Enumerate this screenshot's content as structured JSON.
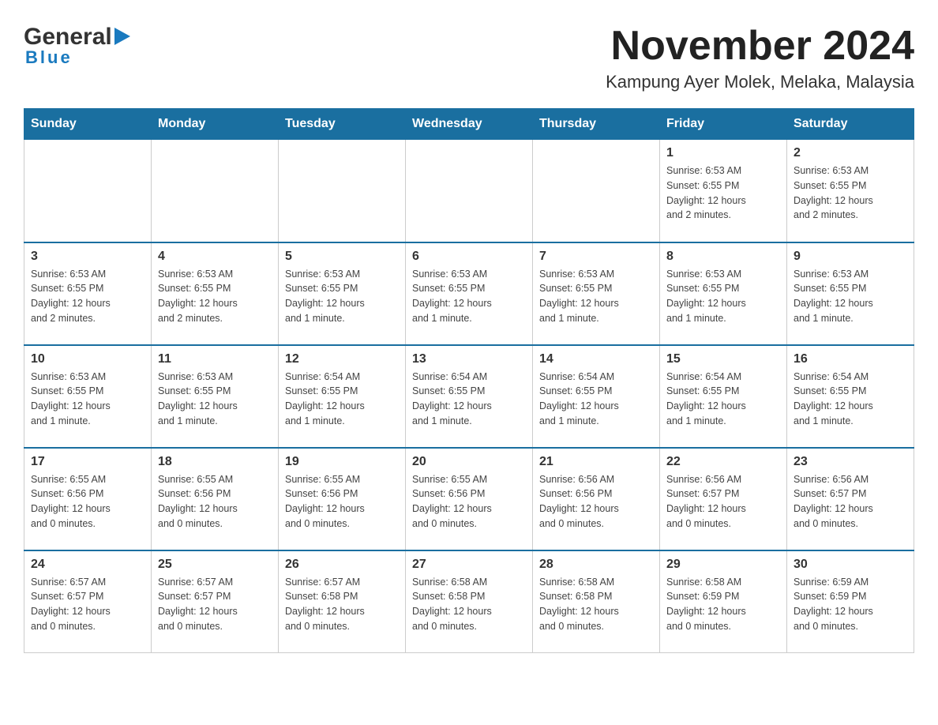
{
  "logo": {
    "text_general": "General",
    "text_blue": "Blue",
    "triangle_char": "▶"
  },
  "title": "November 2024",
  "subtitle": "Kampung Ayer Molek, Melaka, Malaysia",
  "weekdays": [
    "Sunday",
    "Monday",
    "Tuesday",
    "Wednesday",
    "Thursday",
    "Friday",
    "Saturday"
  ],
  "weeks": [
    [
      {
        "day": "",
        "info": ""
      },
      {
        "day": "",
        "info": ""
      },
      {
        "day": "",
        "info": ""
      },
      {
        "day": "",
        "info": ""
      },
      {
        "day": "",
        "info": ""
      },
      {
        "day": "1",
        "info": "Sunrise: 6:53 AM\nSunset: 6:55 PM\nDaylight: 12 hours\nand 2 minutes."
      },
      {
        "day": "2",
        "info": "Sunrise: 6:53 AM\nSunset: 6:55 PM\nDaylight: 12 hours\nand 2 minutes."
      }
    ],
    [
      {
        "day": "3",
        "info": "Sunrise: 6:53 AM\nSunset: 6:55 PM\nDaylight: 12 hours\nand 2 minutes."
      },
      {
        "day": "4",
        "info": "Sunrise: 6:53 AM\nSunset: 6:55 PM\nDaylight: 12 hours\nand 2 minutes."
      },
      {
        "day": "5",
        "info": "Sunrise: 6:53 AM\nSunset: 6:55 PM\nDaylight: 12 hours\nand 1 minute."
      },
      {
        "day": "6",
        "info": "Sunrise: 6:53 AM\nSunset: 6:55 PM\nDaylight: 12 hours\nand 1 minute."
      },
      {
        "day": "7",
        "info": "Sunrise: 6:53 AM\nSunset: 6:55 PM\nDaylight: 12 hours\nand 1 minute."
      },
      {
        "day": "8",
        "info": "Sunrise: 6:53 AM\nSunset: 6:55 PM\nDaylight: 12 hours\nand 1 minute."
      },
      {
        "day": "9",
        "info": "Sunrise: 6:53 AM\nSunset: 6:55 PM\nDaylight: 12 hours\nand 1 minute."
      }
    ],
    [
      {
        "day": "10",
        "info": "Sunrise: 6:53 AM\nSunset: 6:55 PM\nDaylight: 12 hours\nand 1 minute."
      },
      {
        "day": "11",
        "info": "Sunrise: 6:53 AM\nSunset: 6:55 PM\nDaylight: 12 hours\nand 1 minute."
      },
      {
        "day": "12",
        "info": "Sunrise: 6:54 AM\nSunset: 6:55 PM\nDaylight: 12 hours\nand 1 minute."
      },
      {
        "day": "13",
        "info": "Sunrise: 6:54 AM\nSunset: 6:55 PM\nDaylight: 12 hours\nand 1 minute."
      },
      {
        "day": "14",
        "info": "Sunrise: 6:54 AM\nSunset: 6:55 PM\nDaylight: 12 hours\nand 1 minute."
      },
      {
        "day": "15",
        "info": "Sunrise: 6:54 AM\nSunset: 6:55 PM\nDaylight: 12 hours\nand 1 minute."
      },
      {
        "day": "16",
        "info": "Sunrise: 6:54 AM\nSunset: 6:55 PM\nDaylight: 12 hours\nand 1 minute."
      }
    ],
    [
      {
        "day": "17",
        "info": "Sunrise: 6:55 AM\nSunset: 6:56 PM\nDaylight: 12 hours\nand 0 minutes."
      },
      {
        "day": "18",
        "info": "Sunrise: 6:55 AM\nSunset: 6:56 PM\nDaylight: 12 hours\nand 0 minutes."
      },
      {
        "day": "19",
        "info": "Sunrise: 6:55 AM\nSunset: 6:56 PM\nDaylight: 12 hours\nand 0 minutes."
      },
      {
        "day": "20",
        "info": "Sunrise: 6:55 AM\nSunset: 6:56 PM\nDaylight: 12 hours\nand 0 minutes."
      },
      {
        "day": "21",
        "info": "Sunrise: 6:56 AM\nSunset: 6:56 PM\nDaylight: 12 hours\nand 0 minutes."
      },
      {
        "day": "22",
        "info": "Sunrise: 6:56 AM\nSunset: 6:57 PM\nDaylight: 12 hours\nand 0 minutes."
      },
      {
        "day": "23",
        "info": "Sunrise: 6:56 AM\nSunset: 6:57 PM\nDaylight: 12 hours\nand 0 minutes."
      }
    ],
    [
      {
        "day": "24",
        "info": "Sunrise: 6:57 AM\nSunset: 6:57 PM\nDaylight: 12 hours\nand 0 minutes."
      },
      {
        "day": "25",
        "info": "Sunrise: 6:57 AM\nSunset: 6:57 PM\nDaylight: 12 hours\nand 0 minutes."
      },
      {
        "day": "26",
        "info": "Sunrise: 6:57 AM\nSunset: 6:58 PM\nDaylight: 12 hours\nand 0 minutes."
      },
      {
        "day": "27",
        "info": "Sunrise: 6:58 AM\nSunset: 6:58 PM\nDaylight: 12 hours\nand 0 minutes."
      },
      {
        "day": "28",
        "info": "Sunrise: 6:58 AM\nSunset: 6:58 PM\nDaylight: 12 hours\nand 0 minutes."
      },
      {
        "day": "29",
        "info": "Sunrise: 6:58 AM\nSunset: 6:59 PM\nDaylight: 12 hours\nand 0 minutes."
      },
      {
        "day": "30",
        "info": "Sunrise: 6:59 AM\nSunset: 6:59 PM\nDaylight: 12 hours\nand 0 minutes."
      }
    ]
  ]
}
